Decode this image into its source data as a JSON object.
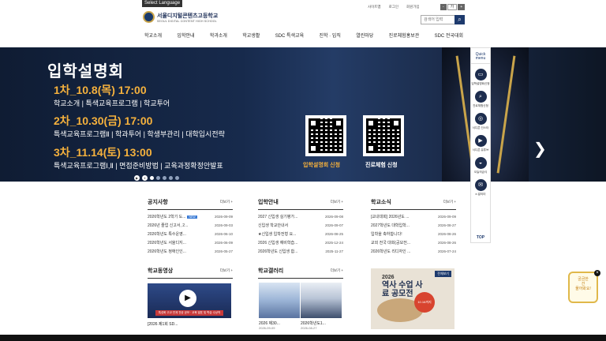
{
  "header": {
    "select_language": "Select Language",
    "school_name_ko": "서울디지털콘텐츠고등학교",
    "school_name_en": "SEOUL DIGITAL CONTENT HIGH SCHOOL",
    "util_links": [
      "사이트맵",
      "로그인",
      "회원가입"
    ],
    "font_label": "가",
    "font_minus": "-",
    "font_plus": "+",
    "search_placeholder": "검색어 입력",
    "search_icon": "search-icon"
  },
  "nav": [
    "학교소개",
    "입학안내",
    "학과소개",
    "학교생활",
    "SDC 특색교육",
    "진학 · 입직",
    "열린마당",
    "진로체험홍보관",
    "SDC 전국대회"
  ],
  "hero": {
    "title": "입학설명회",
    "sessions": [
      {
        "date": "1차_10.8(목) 17:00",
        "desc": "학교소개 | 특색교육프로그램 | 학교투어"
      },
      {
        "date": "2차_10.30(금) 17:00",
        "desc": "특색교육프로그램Ⅱ | 학과투어 | 학생부관리 | 대학입시전략"
      },
      {
        "date": "3차_11.14(토) 13:00",
        "desc": "특색교육프로그램Ⅰ,Ⅱ | 면접준비방법 | 교육과정확정안발표"
      }
    ],
    "qr1_label": "입학설명회 신청",
    "qr2_label": "진로체험 신청",
    "next": "❯"
  },
  "slider": {
    "play": "▶",
    "pause": "⏸",
    "count": 5,
    "active": 0
  },
  "quick_menu": {
    "title_1": "Quick",
    "title_2": "menu",
    "items": [
      {
        "label": "입학설명회신청",
        "icon": "monitor-icon",
        "glyph": "▭"
      },
      {
        "label": "진로체험신청",
        "icon": "magnifier-icon",
        "glyph": "⌕"
      },
      {
        "label": "서디콘 인스타",
        "icon": "instagram-icon",
        "glyph": "◎"
      },
      {
        "label": "서디콘 유튜브",
        "icon": "youtube-icon",
        "glyph": "▶"
      },
      {
        "label": "오늘의급식",
        "icon": "meal-icon",
        "glyph": "◒"
      },
      {
        "label": "e-알리미",
        "icon": "mail-icon",
        "glyph": "✉"
      }
    ],
    "top": "TOP"
  },
  "boards": [
    {
      "title": "공지사항",
      "more": "더보기 +",
      "rows": [
        {
          "title": "2026학년도 2학기 도...",
          "new": "NEW",
          "date": "2026-09-09"
        },
        {
          "title": "2026년 졸업 신고서, 2...",
          "date": "2026-09-03"
        },
        {
          "title": "2026학년도 특수운영...",
          "date": "2026-06-10"
        },
        {
          "title": "2026학년도 서울디지...",
          "date": "2026-06-09"
        },
        {
          "title": "2026학년도 정애인인...",
          "date": "2026-05-27"
        }
      ]
    },
    {
      "title": "입학안내",
      "more": "더보기 +",
      "rows": [
        {
          "title": "2027 신입생 실기평가...",
          "date": "2026-09-08"
        },
        {
          "title": "신입생 학교안내서",
          "date": "2026-09-07"
        },
        {
          "title": "★신입생 입학전형 요...",
          "date": "2026-08-25"
        },
        {
          "title": "2026 신입생 예비학습...",
          "date": "2025-12-24"
        },
        {
          "title": "2026학년도 신입생 합...",
          "date": "2025-11-27"
        }
      ]
    },
    {
      "title": "학교소식",
      "more": "더보기 +",
      "rows": [
        {
          "title": "[교내대회] 2026년도 ...",
          "date": "2026-09-09"
        },
        {
          "title": "2027학년도 대학입학...",
          "date": "2026-08-27"
        },
        {
          "title": "입학을 축하합니다!",
          "date": "2026-08-26"
        },
        {
          "title": "교외 전국 대회(공모전...",
          "date": "2026-08-26"
        },
        {
          "title": "2026학년도 리디자인 ...",
          "date": "2026-07-24"
        }
      ]
    }
  ],
  "video_section": {
    "title": "학교동영상",
    "more": "더보기 +",
    "caption": "[2026 제1회 SD...",
    "banner": "특성화 고교 연계 전공 공모 · 교육 발표 및 학습 수상작",
    "play": "▶"
  },
  "gallery_section": {
    "title": "학교갤러리",
    "more": "더보기 +",
    "items": [
      {
        "caption": "2026 제30...",
        "date": "2026-09-09"
      },
      {
        "caption": "2026학년도1...",
        "date": "2026-08-27"
      }
    ]
  },
  "poster": {
    "badge": "전체보기",
    "year": "2026",
    "headline": "역사 수업 사료 공모전",
    "stamp": "10.16까지"
  },
  "chat_badge": {
    "line1": "궁금한",
    "line2": "건",
    "line3": "물어봐요!"
  },
  "chat_close": "×"
}
